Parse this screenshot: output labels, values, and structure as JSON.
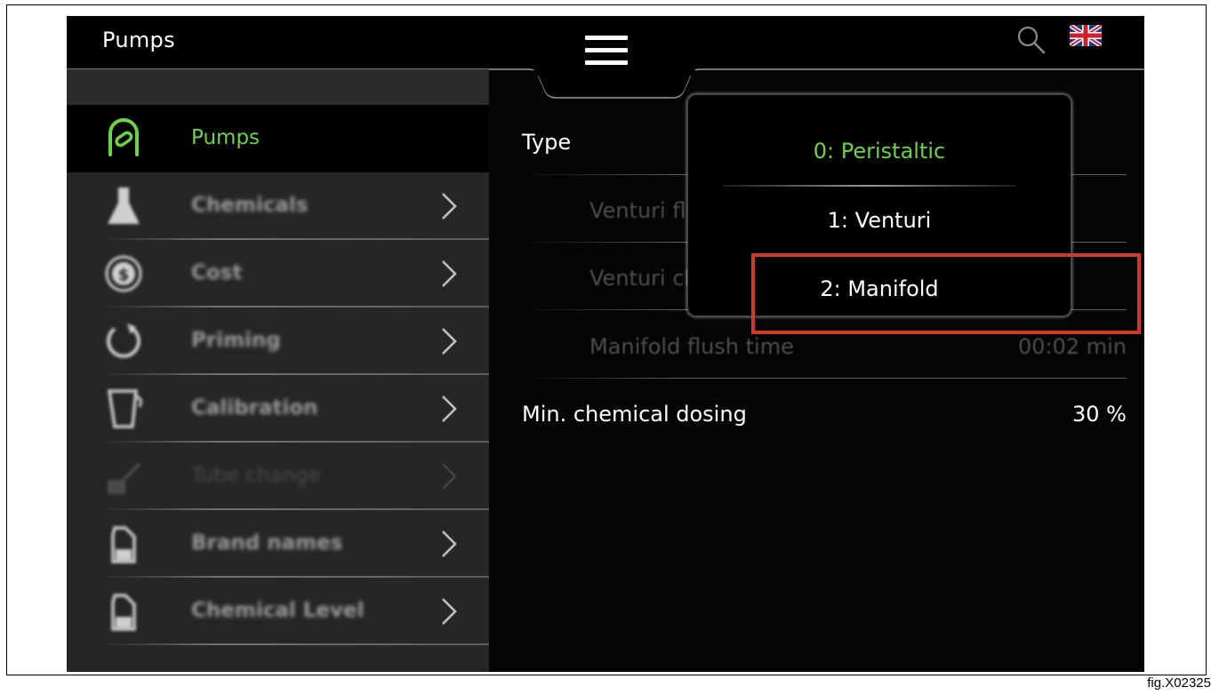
{
  "header": {
    "title": "Pumps",
    "menu_icon": "hamburger-menu-icon",
    "search_icon": "search-icon",
    "language_icon": "uk-flag-icon"
  },
  "sidebar": {
    "items": [
      {
        "label": "Pumps",
        "icon": "pump-icon",
        "active": true
      },
      {
        "label": "Chemicals",
        "icon": "flask-icon"
      },
      {
        "label": "Cost",
        "icon": "dollar-coin-icon"
      },
      {
        "label": "Priming",
        "icon": "refresh-icon"
      },
      {
        "label": "Calibration",
        "icon": "measuring-cup-icon"
      },
      {
        "label": "Tube change",
        "icon": "tube-change-icon",
        "disabled": true
      },
      {
        "label": "Brand names",
        "icon": "bottle-icon"
      },
      {
        "label": "Chemical Level",
        "icon": "bottle-icon"
      }
    ]
  },
  "content": {
    "rows": [
      {
        "label": "Type",
        "value": ""
      },
      {
        "label": "Venturi flush",
        "value": ""
      },
      {
        "label": "Venturi clear",
        "value": ""
      },
      {
        "label": "Manifold flush time",
        "value": "00:02 min"
      },
      {
        "label": "Min. chemical dosing",
        "value": "30 %"
      }
    ]
  },
  "dropdown": {
    "options": [
      {
        "label": "0: Peristaltic",
        "selected": true
      },
      {
        "label": "1: Venturi"
      },
      {
        "label": "2: Manifold"
      }
    ]
  },
  "colors": {
    "accent_green": "#6bd446",
    "highlight_red": "#d0392b"
  },
  "figure_label": "fig.X02325"
}
